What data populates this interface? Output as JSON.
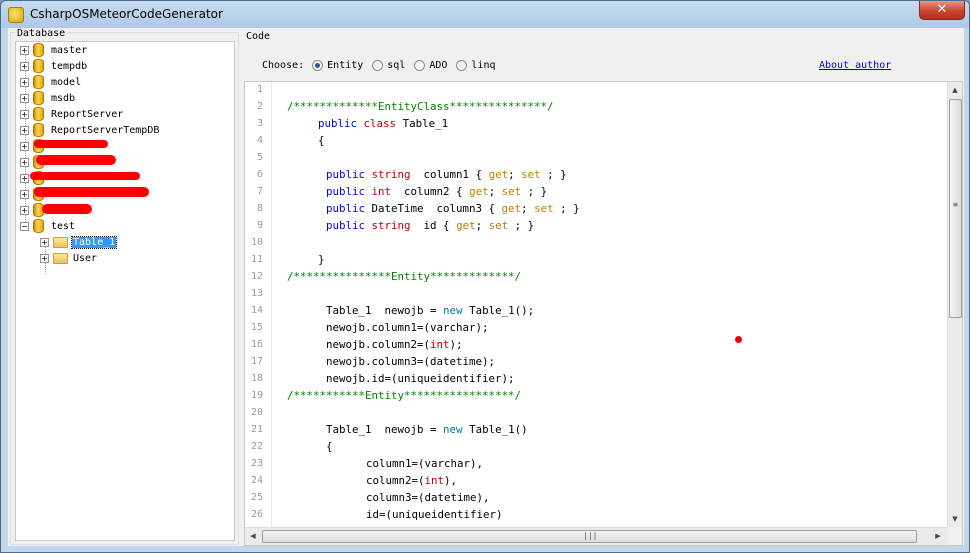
{
  "window": {
    "title": "CsharpOSMeteorCodeGenerator",
    "close_label": "✕"
  },
  "database_panel": {
    "label": "Database",
    "databases": [
      "master",
      "tempdb",
      "model",
      "msdb",
      "ReportServer",
      "ReportServerTempDB"
    ],
    "expanded_db": "test",
    "tables": [
      "Table_1",
      "User"
    ],
    "selected_table": "Table_1"
  },
  "code_panel": {
    "label": "Code",
    "choose_label": "Choose:",
    "options": [
      {
        "label": "Entity",
        "checked": true
      },
      {
        "label": "sql",
        "checked": false
      },
      {
        "label": "ADO",
        "checked": false
      },
      {
        "label": "linq",
        "checked": false
      }
    ],
    "about_link": "About author"
  },
  "editor": {
    "lines": [
      {
        "num": "1"
      },
      {
        "num": "2",
        "text": "/*************EntityClass***************/"
      },
      {
        "num": "3",
        "text": "class Table_1"
      },
      {
        "num": "4",
        "text": "{"
      },
      {
        "num": "5"
      },
      {
        "num": "6",
        "text": "column1 { get; set ; }"
      },
      {
        "num": "7",
        "text": "column2 { get; set ; }"
      },
      {
        "num": "8",
        "text": "DateTime  column3 { get; set ; }"
      },
      {
        "num": "9",
        "text": "id { get; set ; }"
      },
      {
        "num": "10"
      },
      {
        "num": "11",
        "text": "}"
      },
      {
        "num": "12",
        "text": "/***************Entity*************/"
      },
      {
        "num": "13"
      },
      {
        "num": "14",
        "text": "Table_1  newojb = new Table_1();"
      },
      {
        "num": "15",
        "text": "newojb.column1=(varchar);"
      },
      {
        "num": "16",
        "text": "newojb.column2=(int);"
      },
      {
        "num": "17",
        "text": "newojb.column3=(datetime);"
      },
      {
        "num": "18",
        "text": "newojb.id=(uniqueidentifier);"
      },
      {
        "num": "19",
        "text": "/***********Entity*****************/"
      },
      {
        "num": "20"
      },
      {
        "num": "21",
        "text": "Table_1  newojb = new Table_1()"
      },
      {
        "num": "22",
        "text": "{"
      },
      {
        "num": "23",
        "text": "column1=(varchar),"
      },
      {
        "num": "24",
        "text": "column2=(int),"
      },
      {
        "num": "25",
        "text": "column3=(datetime),"
      },
      {
        "num": "26",
        "text": "id=(uniqueidentifier)"
      }
    ],
    "tokens": {
      "public": "public",
      "class": "class",
      "string": "string",
      "int": "int",
      "new": "new",
      "get": "get",
      "set": "set",
      "table": "Table_1",
      "newojb": "newojb"
    }
  },
  "colors": {
    "comment": "#008000",
    "keyword": "#0000ff",
    "type": "#c00000",
    "new_kw": "#007a9c",
    "accessor": "#bf7b00",
    "selection": "#3399ff"
  }
}
